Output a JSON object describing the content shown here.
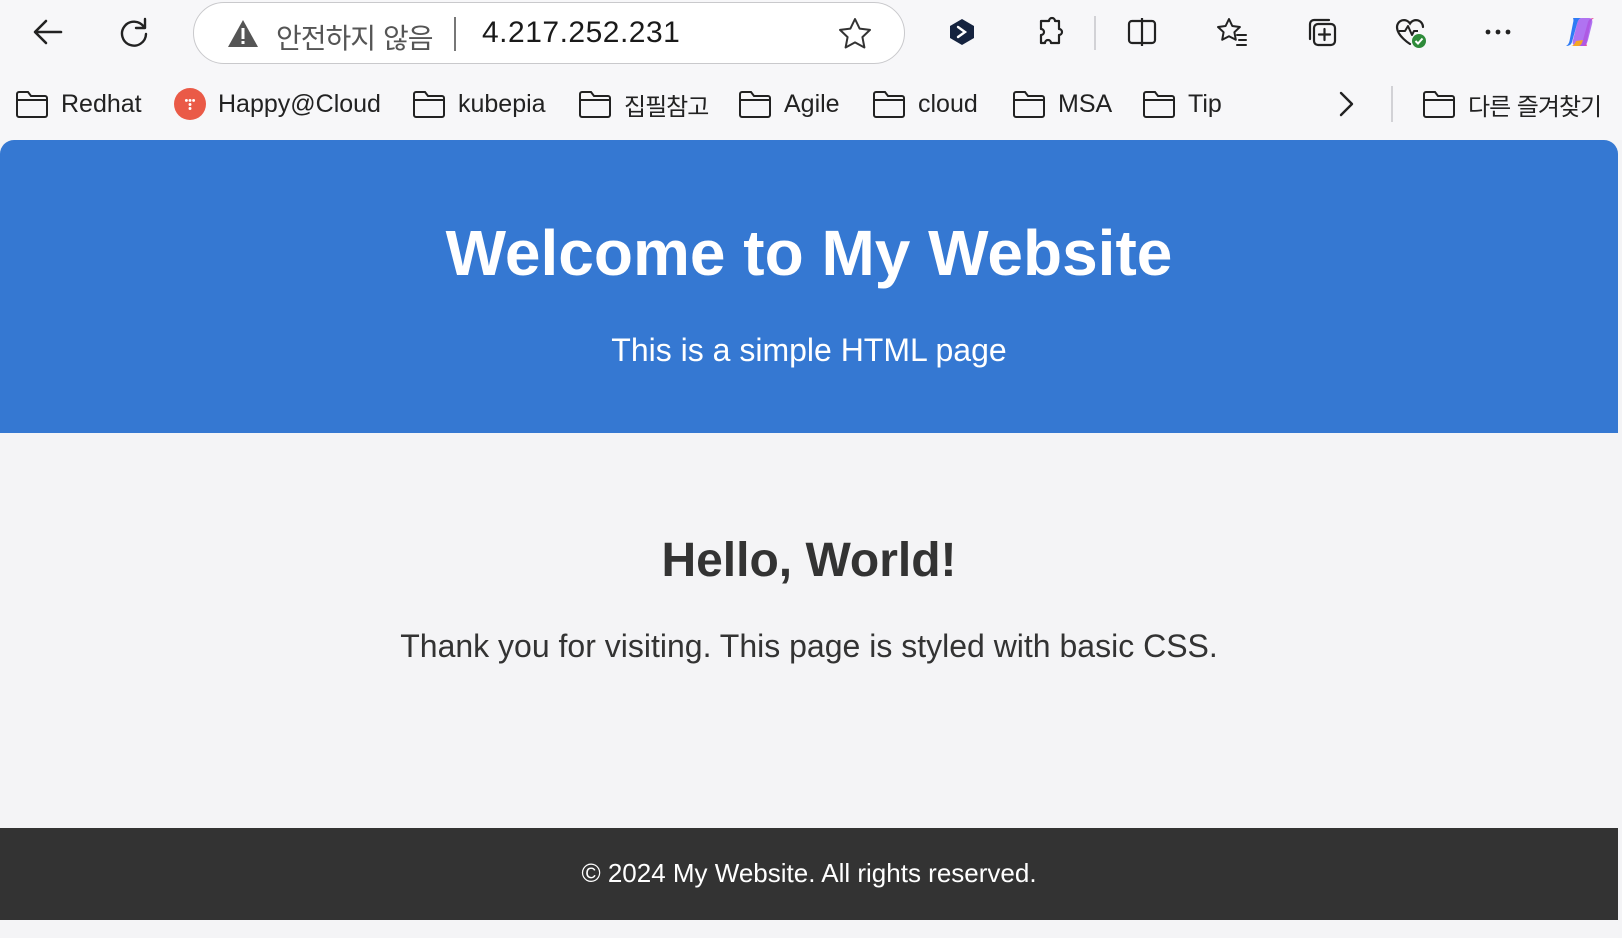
{
  "browser": {
    "security_label": "안전하지 않음",
    "url": "4.217.252.231",
    "bookmarks": [
      {
        "label": "Redhat"
      },
      {
        "label": "Happy@Cloud"
      },
      {
        "label": "kubepia"
      },
      {
        "label": "집필참고"
      },
      {
        "label": "Agile"
      },
      {
        "label": "cloud"
      },
      {
        "label": "MSA"
      },
      {
        "label": "Tip"
      }
    ],
    "other_bookmarks": "다른 즐겨찾기"
  },
  "page": {
    "header_title": "Welcome to My Website",
    "header_subtitle": "This is a simple HTML page",
    "main_heading": "Hello, World!",
    "main_text": "Thank you for visiting. This page is styled with basic CSS.",
    "footer_text": "© 2024 My Website. All rights reserved."
  },
  "colors": {
    "header_bg": "#3578d2",
    "footer_bg": "#333333",
    "page_bg": "#f4f4f6"
  }
}
